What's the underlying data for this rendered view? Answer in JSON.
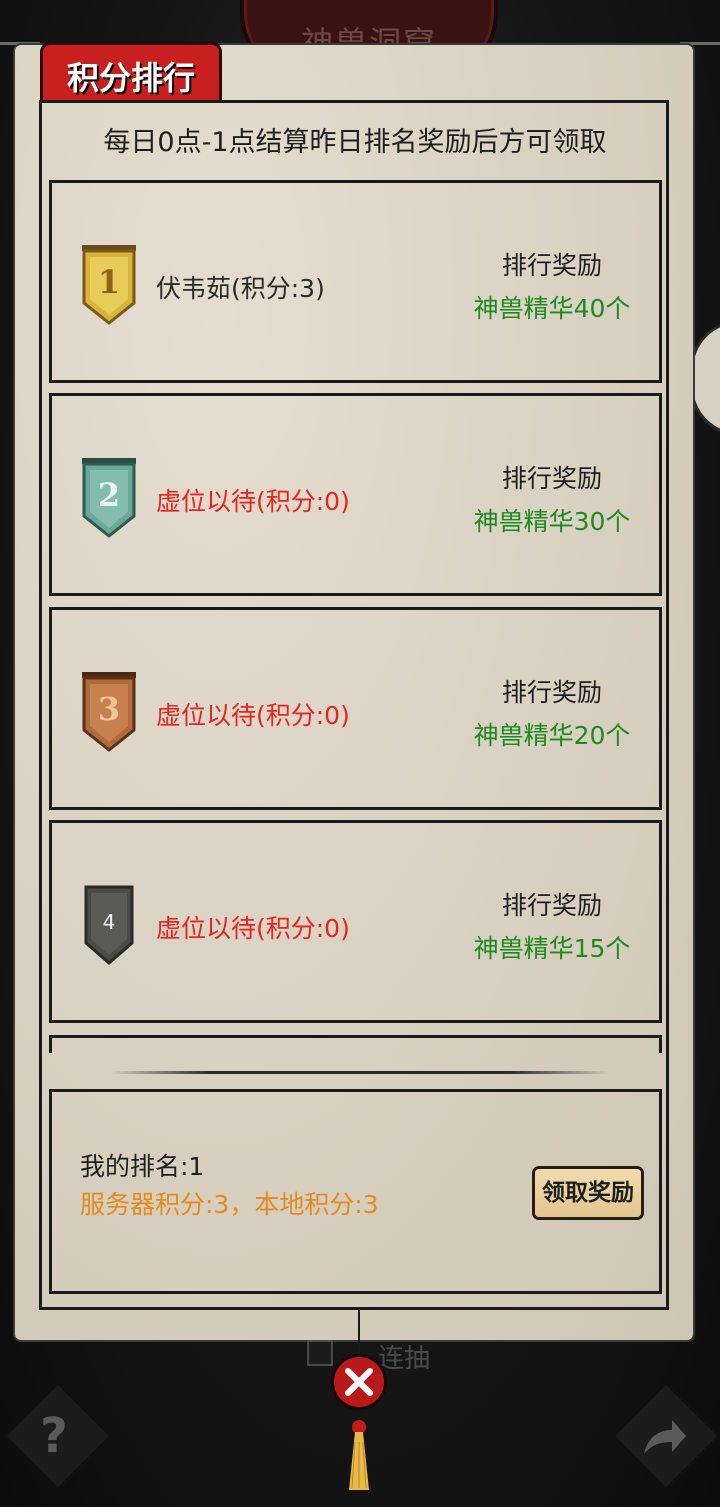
{
  "header": {
    "title": "神兽洞窟"
  },
  "panel": {
    "tag": "积分排行",
    "notice": "每日0点-1点结算昨日排名奖励后方可领取"
  },
  "rankings": [
    {
      "rank": "1",
      "name": "伏韦茹(积分:3)",
      "reward_title": "排行奖励",
      "reward": "神兽精华40个",
      "badge_color": "#d8b43a"
    },
    {
      "rank": "2",
      "name": "虚位以待(积分:0)",
      "reward_title": "排行奖励",
      "reward": "神兽精华30个",
      "badge_color": "#6aa89a"
    },
    {
      "rank": "3",
      "name": "虚位以待(积分:0)",
      "reward_title": "排行奖励",
      "reward": "神兽精华20个",
      "badge_color": "#b06a3e"
    },
    {
      "rank": "4",
      "name": "虚位以待(积分:0)",
      "reward_title": "排行奖励",
      "reward": "神兽精华15个",
      "badge_color": "#4a4a46"
    }
  ],
  "mine": {
    "rank": "我的排名:1",
    "score": "服务器积分:3，本地积分:3",
    "claim_label": "领取奖励"
  },
  "footer": {
    "continuous_draw_label": "连抽"
  },
  "colors": {
    "accent_red": "#c8201e",
    "reward_green": "#1f8a1f",
    "placeholder_red": "#e8241e",
    "score_orange": "#e58a1c"
  },
  "icons": {
    "close": "close-icon",
    "help": "question-icon",
    "share": "share-arrow-icon"
  }
}
